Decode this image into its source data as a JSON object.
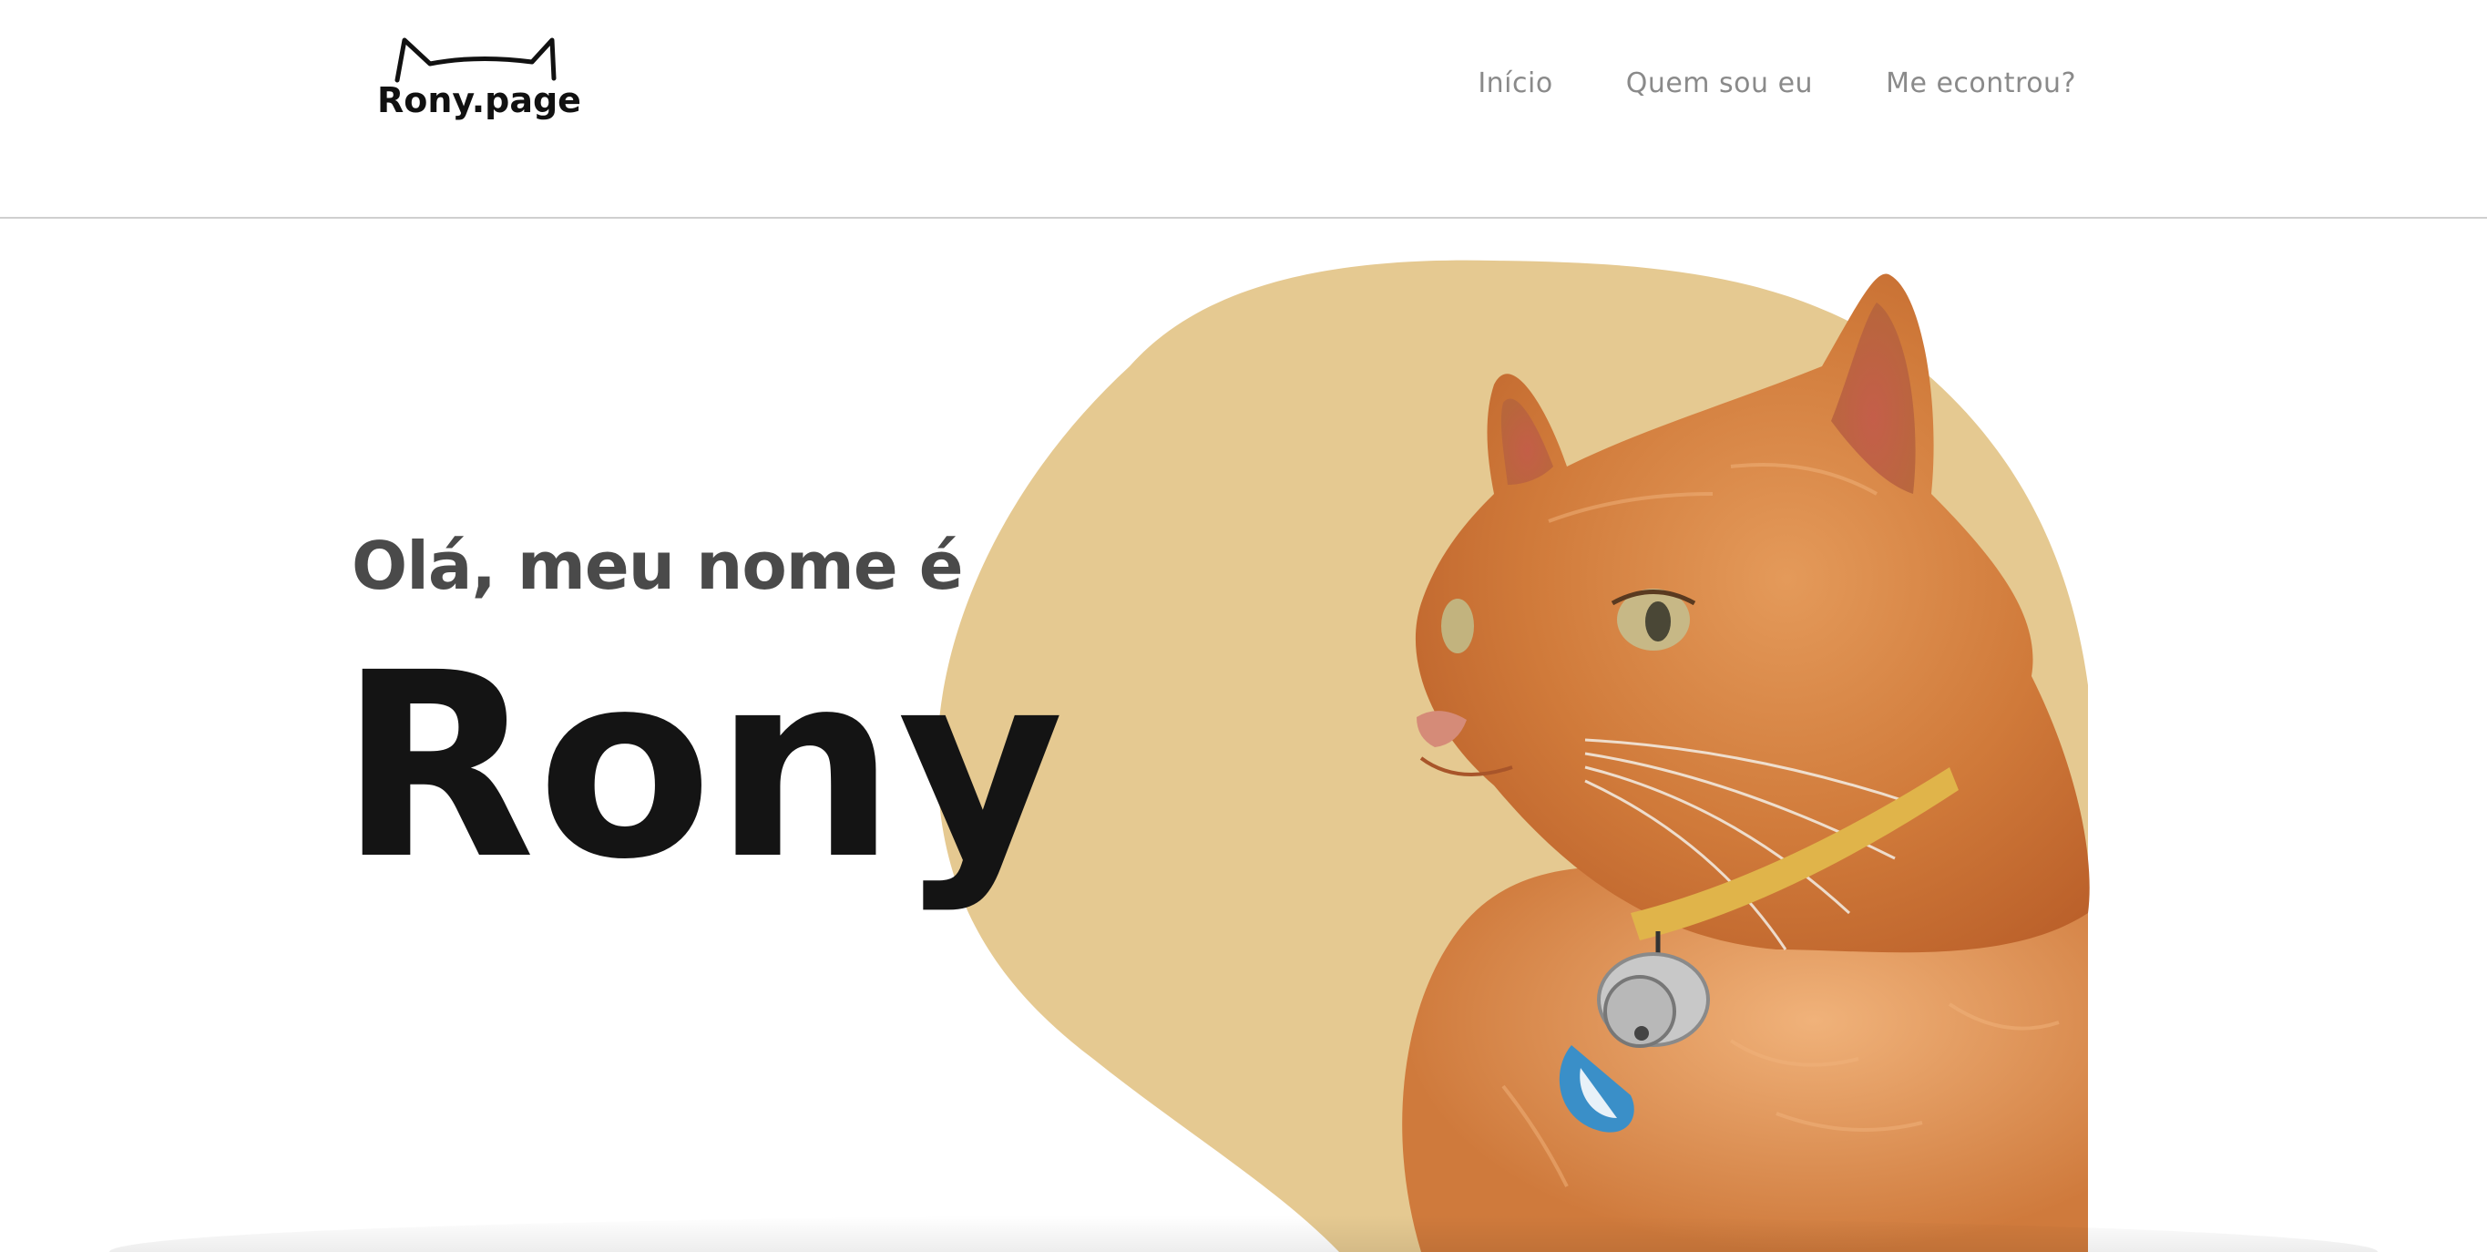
{
  "header": {
    "logo_text": "Rony.page",
    "nav": [
      {
        "label": "Início"
      },
      {
        "label": "Quem sou eu"
      },
      {
        "label": "Me econtrou?"
      }
    ]
  },
  "hero": {
    "greeting": "Olá, meu nome é",
    "name": "Rony"
  },
  "colors": {
    "blob": "#e5c991",
    "heading_dark": "#141414",
    "greeting": "#4a4a4a",
    "nav_text": "#8a8a8a",
    "cat_fur": "#d27c3c"
  },
  "icons": {
    "logo": "cat-ears-logo-icon",
    "photo": "orange-cat-photo"
  }
}
